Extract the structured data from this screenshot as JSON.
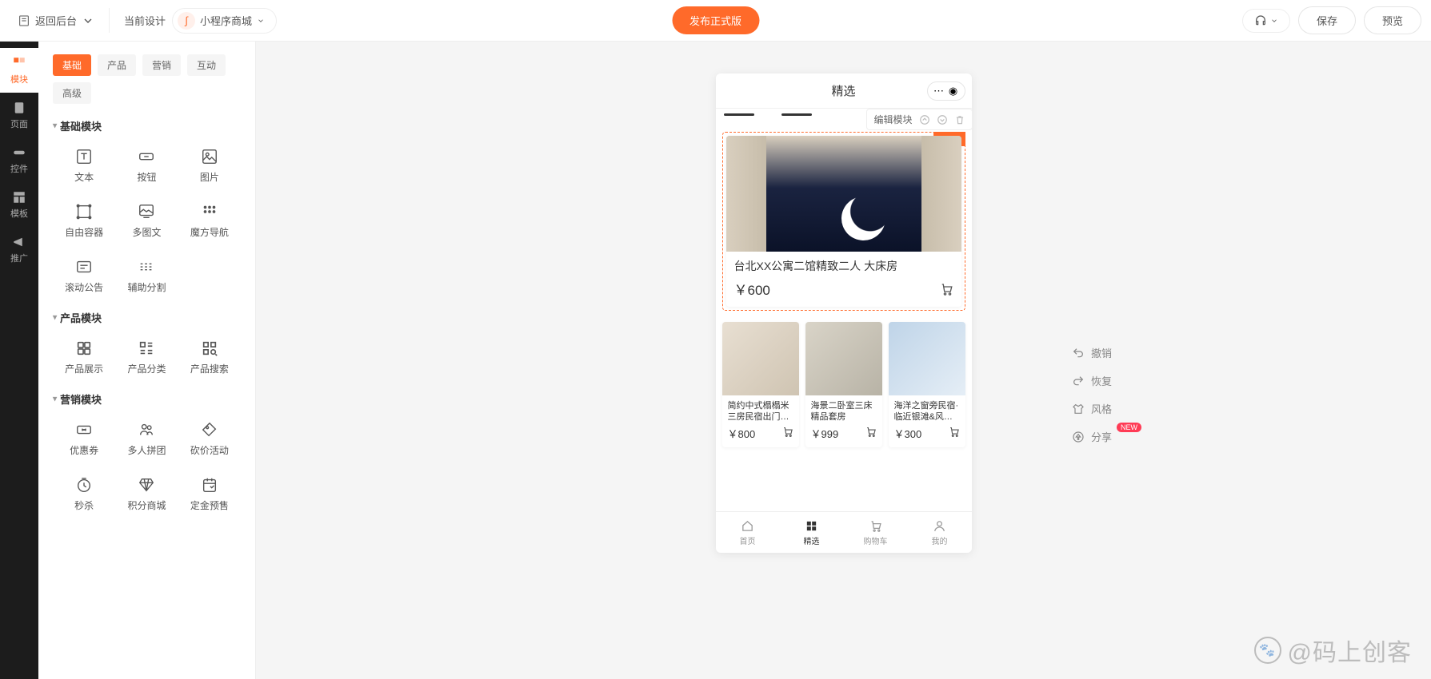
{
  "topbar": {
    "back": "返回后台",
    "design_label": "当前设计",
    "app_name": "小程序商城",
    "publish": "发布正式版",
    "save": "保存",
    "preview": "预览"
  },
  "leftnav": [
    {
      "label": "模块"
    },
    {
      "label": "页面"
    },
    {
      "label": "控件"
    },
    {
      "label": "模板"
    },
    {
      "label": "推广"
    }
  ],
  "module_tabs": {
    "t0": "基础",
    "t1": "产品",
    "t2": "营销",
    "t3": "互动",
    "t4": "高级"
  },
  "sections": {
    "basic_title": "基础模块",
    "basic": [
      "文本",
      "按钮",
      "图片",
      "自由容器",
      "多图文",
      "魔方导航",
      "滚动公告",
      "辅助分割"
    ],
    "product_title": "产品模块",
    "product": [
      "产品展示",
      "产品分类",
      "产品搜索"
    ],
    "marketing_title": "营销模块",
    "marketing": [
      "优惠券",
      "多人拼团",
      "砍价活动",
      "秒杀",
      "积分商城",
      "定金预售"
    ]
  },
  "phone": {
    "title": "精选",
    "edit_label": "编辑模块",
    "big": {
      "title": "台北XX公寓二馆精致二人 大床房",
      "price": "￥600"
    },
    "small": [
      {
        "title": "简约中式榻榻米三房民宿出门…",
        "price": "￥800"
      },
      {
        "title": "海景二卧室三床精品套房",
        "price": "￥999"
      },
      {
        "title": "海洋之窗旁民宿·临近银滩&风…",
        "price": "￥300"
      }
    ],
    "tabbar": [
      "首页",
      "精选",
      "购物车",
      "我的"
    ]
  },
  "side": {
    "undo": "撤销",
    "redo": "恢复",
    "style": "风格",
    "share": "分享",
    "new": "NEW"
  },
  "watermark": "@码上创客"
}
